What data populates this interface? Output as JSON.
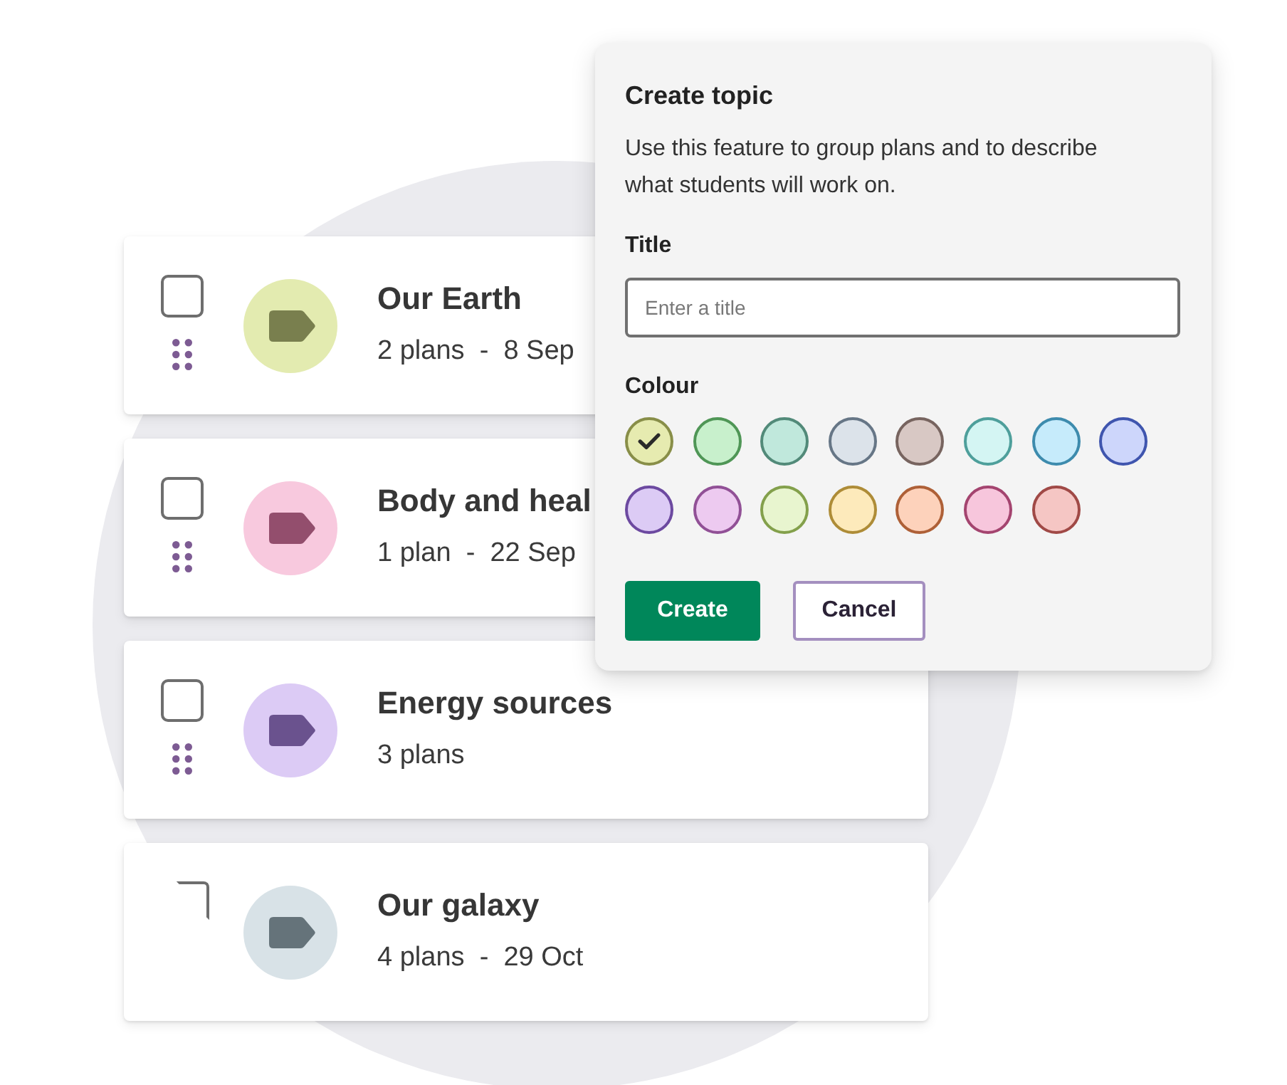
{
  "topics": [
    {
      "title": "Our Earth",
      "meta": "2 plans  -  8 Sep",
      "color": "#e3ebb0",
      "checked": false
    },
    {
      "title": "Body and heal",
      "meta": "1 plan  -  22 Sep",
      "color": "#f8c9de",
      "checked": false
    },
    {
      "title": "Energy sources",
      "meta": "3 plans",
      "color": "#dccbf5",
      "checked": false
    },
    {
      "title": "Our galaxy",
      "meta": "4 plans  -  29 Oct",
      "color": "#d8e2e7",
      "checked": false
    }
  ],
  "dialog": {
    "title": "Create topic",
    "description": "Use this feature to group plans and to describe what students will work on.",
    "title_label": "Title",
    "title_field": {
      "placeholder": "Enter a title"
    },
    "colour_label": "Colour",
    "colours": [
      {
        "color": "#e6ebb0",
        "selected": true
      },
      {
        "color": "#c8f0cc",
        "selected": false
      },
      {
        "color": "#c0e8dc",
        "selected": false
      },
      {
        "color": "#dce3ea",
        "selected": false
      },
      {
        "color": "#d8c8c4",
        "selected": false
      },
      {
        "color": "#d4f5f3",
        "selected": false
      },
      {
        "color": "#c6ebfb",
        "selected": false
      },
      {
        "color": "#cdd6fb",
        "selected": false
      },
      {
        "color": "#dccbf5",
        "selected": false
      },
      {
        "color": "#edcaf0",
        "selected": false
      },
      {
        "color": "#e8f5cf",
        "selected": false
      },
      {
        "color": "#fdeabb",
        "selected": false
      },
      {
        "color": "#fdd2bb",
        "selected": false
      },
      {
        "color": "#f7c6dc",
        "selected": false
      },
      {
        "color": "#f5c6c4",
        "selected": false
      }
    ],
    "buttons": [
      {
        "label": "Create",
        "kind": "primary"
      },
      {
        "label": "Cancel",
        "kind": "secondary"
      }
    ]
  }
}
